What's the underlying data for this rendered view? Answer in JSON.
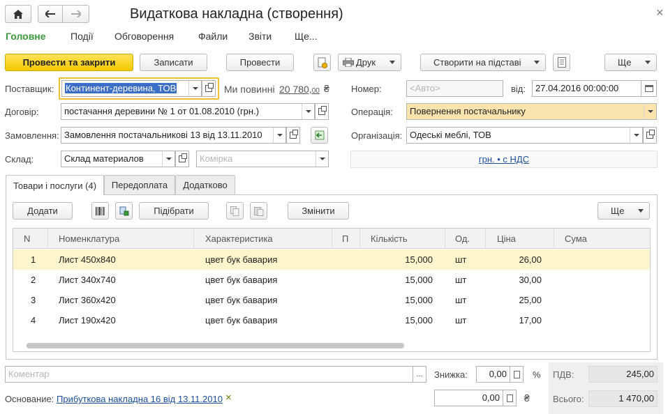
{
  "window": {
    "title": "Видаткова накладна (створення)",
    "close_symbol": "×"
  },
  "menu": {
    "items": [
      "Головне",
      "Події",
      "Обговорення",
      "Файли",
      "Звіти",
      "Ще..."
    ]
  },
  "toolbar": {
    "post_close_label": "Провести та закрити",
    "save_label": "Записати",
    "post_label": "Провести",
    "print_label": "Друк",
    "create_based_label": "Створити на підставі",
    "more_label": "Ще"
  },
  "form": {
    "supplier_label": "Поставщик:",
    "supplier_value": "Континент-деревина, ТОВ",
    "debt_label": "Ми повинні",
    "debt_amount": "20 780,",
    "debt_cents": "00",
    "currency_symbol": "₴",
    "number_label": "Номер:",
    "number_placeholder": "<Авто>",
    "date_label": "від:",
    "date_value": "27.04.2016 00:00:00",
    "contract_label": "Договір:",
    "contract_value": "постачання деревини № 1 от 01.08.2010 (грн.)",
    "operation_label": "Операція:",
    "operation_value": "Повернення постачальнику",
    "order_label": "Замовлення:",
    "order_value": "Замовлення постачальникові 13 від 13.11.2010",
    "organization_label": "Організація:",
    "organization_value": "Одеські меблі, ТОВ",
    "warehouse_label": "Склад:",
    "warehouse_value": "Склад материалов",
    "cell_placeholder": "Комірка",
    "price_mode_link": "грн. • с НДС"
  },
  "tabs": [
    {
      "label": "Товари і послуги (4)",
      "active": true
    },
    {
      "label": "Передоплата",
      "active": false
    },
    {
      "label": "Додатково",
      "active": false
    }
  ],
  "grid_toolbar": {
    "add_label": "Додати",
    "pick_label": "Підібрати",
    "change_label": "Змінити",
    "more_label": "Ще"
  },
  "grid": {
    "columns": [
      "N",
      "Номенклатура",
      "Характеристика",
      "П",
      "Кількість",
      "Од.",
      "Ціна",
      "Сума"
    ],
    "rows": [
      {
        "n": "1",
        "item": "Лист 450x840",
        "char": "цвет бук бавария",
        "qty": "15,000",
        "unit": "шт",
        "price": "26,00",
        "sum": ""
      },
      {
        "n": "2",
        "item": "Лист 340x740",
        "char": "цвет бук бавария",
        "qty": "15,000",
        "unit": "шт",
        "price": "30,00",
        "sum": ""
      },
      {
        "n": "3",
        "item": "Лист 360x420",
        "char": "цвет бук бавария",
        "qty": "15,000",
        "unit": "шт",
        "price": "25,00",
        "sum": ""
      },
      {
        "n": "4",
        "item": "Лист 190x420",
        "char": "цвет бук бавария",
        "qty": "15,000",
        "unit": "шт",
        "price": "17,00",
        "sum": ""
      }
    ]
  },
  "footer": {
    "comment_placeholder": "Коментар",
    "ellipsis": "...",
    "discount_label": "Знижка:",
    "discount_value": "0,00",
    "percent_symbol": "%",
    "amount_value": "0,00",
    "vat_label": "ПДВ:",
    "vat_value": "245,00",
    "total_label": "Всього:",
    "total_value": "1 470,00",
    "basis_label": "Основание:",
    "basis_link": "Прибуткова накладна 16 від 13.11.2010",
    "clear_symbol": "×"
  },
  "colors": {
    "accent_green": "#3a9a3a",
    "primary_button": "#f5c800",
    "selected_row": "#fdf5cc",
    "operation_field": "#fbe3ad",
    "link": "#1b4f9c"
  }
}
